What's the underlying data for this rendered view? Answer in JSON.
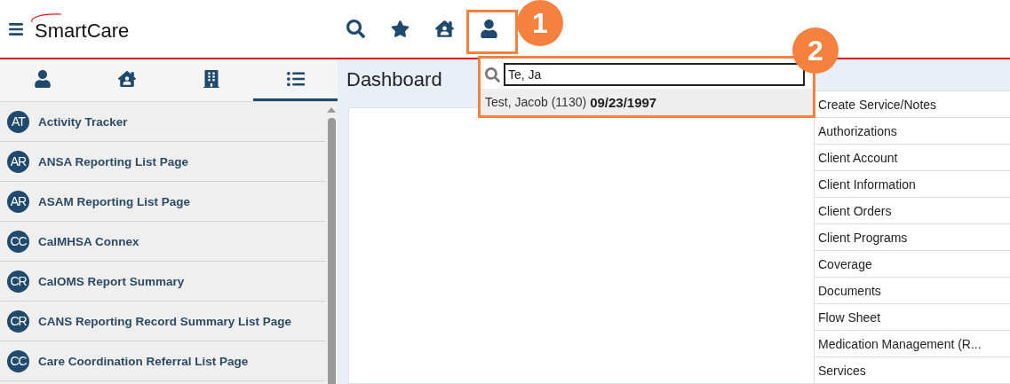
{
  "header": {
    "logo": "SmartCare",
    "toolbar": [
      {
        "kind": "search"
      },
      {
        "kind": "star"
      },
      {
        "kind": "home"
      },
      {
        "kind": "person"
      }
    ]
  },
  "sidebar": {
    "tabs": [
      {
        "kind": "person",
        "selected": false
      },
      {
        "kind": "home",
        "selected": false
      },
      {
        "kind": "building",
        "selected": false
      },
      {
        "kind": "list",
        "selected": true
      }
    ],
    "items": [
      {
        "initials": "AT",
        "label": "Activity Tracker"
      },
      {
        "initials": "AR",
        "label": "ANSA Reporting List Page"
      },
      {
        "initials": "AR",
        "label": "ASAM Reporting List Page"
      },
      {
        "initials": "CC",
        "label": "CalMHSA Connex"
      },
      {
        "initials": "CR",
        "label": "CalOMS Report Summary"
      },
      {
        "initials": "CR",
        "label": "CANS Reporting Record Summary List Page"
      },
      {
        "initials": "CC",
        "label": "Care Coordination Referral List Page"
      }
    ]
  },
  "main": {
    "title": "Dashboard"
  },
  "client_search": {
    "value": "Te, Ja",
    "results": [
      {
        "name": "Test, Jacob (1130)",
        "dob": "09/23/1997"
      }
    ]
  },
  "context_menu": {
    "items": [
      "Create Service/Notes",
      "Authorizations",
      "Client Account",
      "Client Information",
      "Client Orders",
      "Client Programs",
      "Coverage",
      "Documents",
      "Flow Sheet",
      "Medication Management (R...",
      "Services"
    ]
  },
  "annotations": [
    {
      "number": "1"
    },
    {
      "number": "2"
    }
  ]
}
